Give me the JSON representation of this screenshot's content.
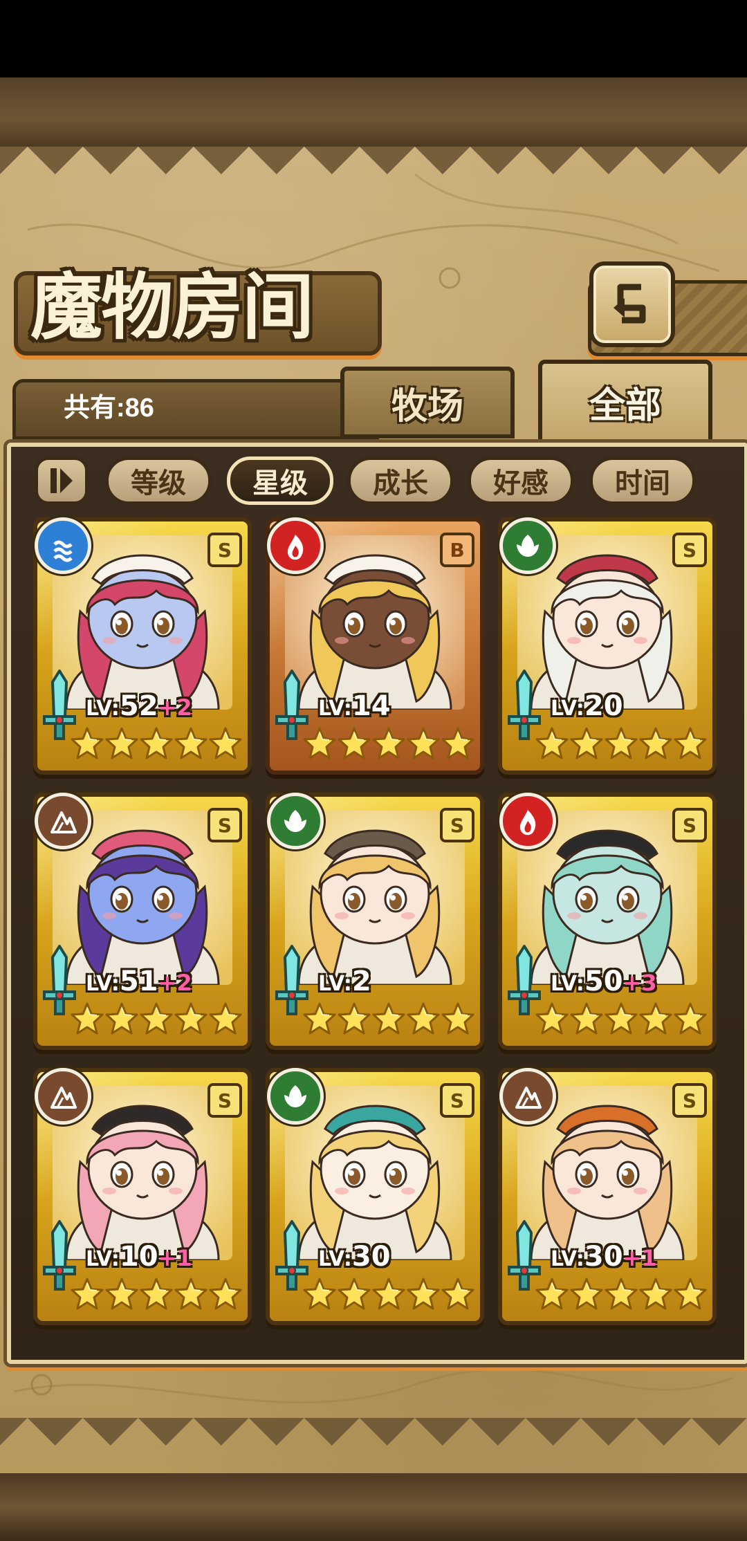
{
  "header": {
    "title": "魔物房间",
    "back_icon": "return-arrow-icon"
  },
  "tabs": [
    {
      "label": "牧场",
      "active": false
    },
    {
      "label": "全部",
      "active": true
    }
  ],
  "count_label": "共有:86",
  "filters": [
    {
      "label": "等级",
      "active": false
    },
    {
      "label": "星级",
      "active": true
    },
    {
      "label": "成长",
      "active": false
    },
    {
      "label": "好感",
      "active": false
    },
    {
      "label": "时间",
      "active": false
    }
  ],
  "colors": {
    "water": "#2e7fd6",
    "fire": "#d32222",
    "nature": "#2e7d32",
    "earth": "#7a4a2e",
    "gold_frame": "#e2b42a",
    "bronze_frame": "#c97a36",
    "plus_text": "#ff5fa8"
  },
  "monsters": [
    {
      "element": "water",
      "rank": "S",
      "frame": "gold",
      "level_label": "LV:",
      "level": "52",
      "plus": "+2",
      "stars": 5,
      "hair": "#d4476a",
      "skin": "#b9c8f0",
      "hat": "#f7f3ea"
    },
    {
      "element": "fire",
      "rank": "B",
      "frame": "bronze",
      "level_label": "LV:",
      "level": "14",
      "plus": "",
      "stars": 5,
      "hair": "#f0c85a",
      "skin": "#7a4e36",
      "hat": "#f7f3ea"
    },
    {
      "element": "nature",
      "rank": "S",
      "frame": "gold",
      "level_label": "LV:",
      "level": "20",
      "plus": "",
      "stars": 5,
      "hair": "#f0f0ea",
      "skin": "#fbe6da",
      "hat": "#c0394a"
    },
    {
      "element": "earth",
      "rank": "S",
      "frame": "gold",
      "level_label": "LV:",
      "level": "51",
      "plus": "+2",
      "stars": 5,
      "hair": "#5a3a9a",
      "skin": "#8fa6f0",
      "hat": "#e05a7a"
    },
    {
      "element": "nature",
      "rank": "S",
      "frame": "gold",
      "level_label": "LV:",
      "level": "2",
      "plus": "",
      "stars": 5,
      "hair": "#f0c46a",
      "skin": "#fbe6da",
      "hat": "#6a5a4a"
    },
    {
      "element": "fire",
      "rank": "S",
      "frame": "gold",
      "level_label": "LV:",
      "level": "50",
      "plus": "+3",
      "stars": 5,
      "hair": "#8fd6c6",
      "skin": "#c6e6e2",
      "hat": "#2a2a2a"
    },
    {
      "element": "earth",
      "rank": "S",
      "frame": "gold",
      "level_label": "LV:",
      "level": "10",
      "plus": "+1",
      "stars": 5,
      "hair": "#f2a6b6",
      "skin": "#fbe6da",
      "hat": "#2e2a2a"
    },
    {
      "element": "nature",
      "rank": "S",
      "frame": "gold",
      "level_label": "LV:",
      "level": "30",
      "plus": "",
      "stars": 5,
      "hair": "#f4d27a",
      "skin": "#fbefe2",
      "hat": "#3aa6a0"
    },
    {
      "element": "earth",
      "rank": "S",
      "frame": "gold",
      "level_label": "LV:",
      "level": "30",
      "plus": "+1",
      "stars": 5,
      "hair": "#f0c08a",
      "skin": "#fbe6da",
      "hat": "#d8702a"
    }
  ]
}
